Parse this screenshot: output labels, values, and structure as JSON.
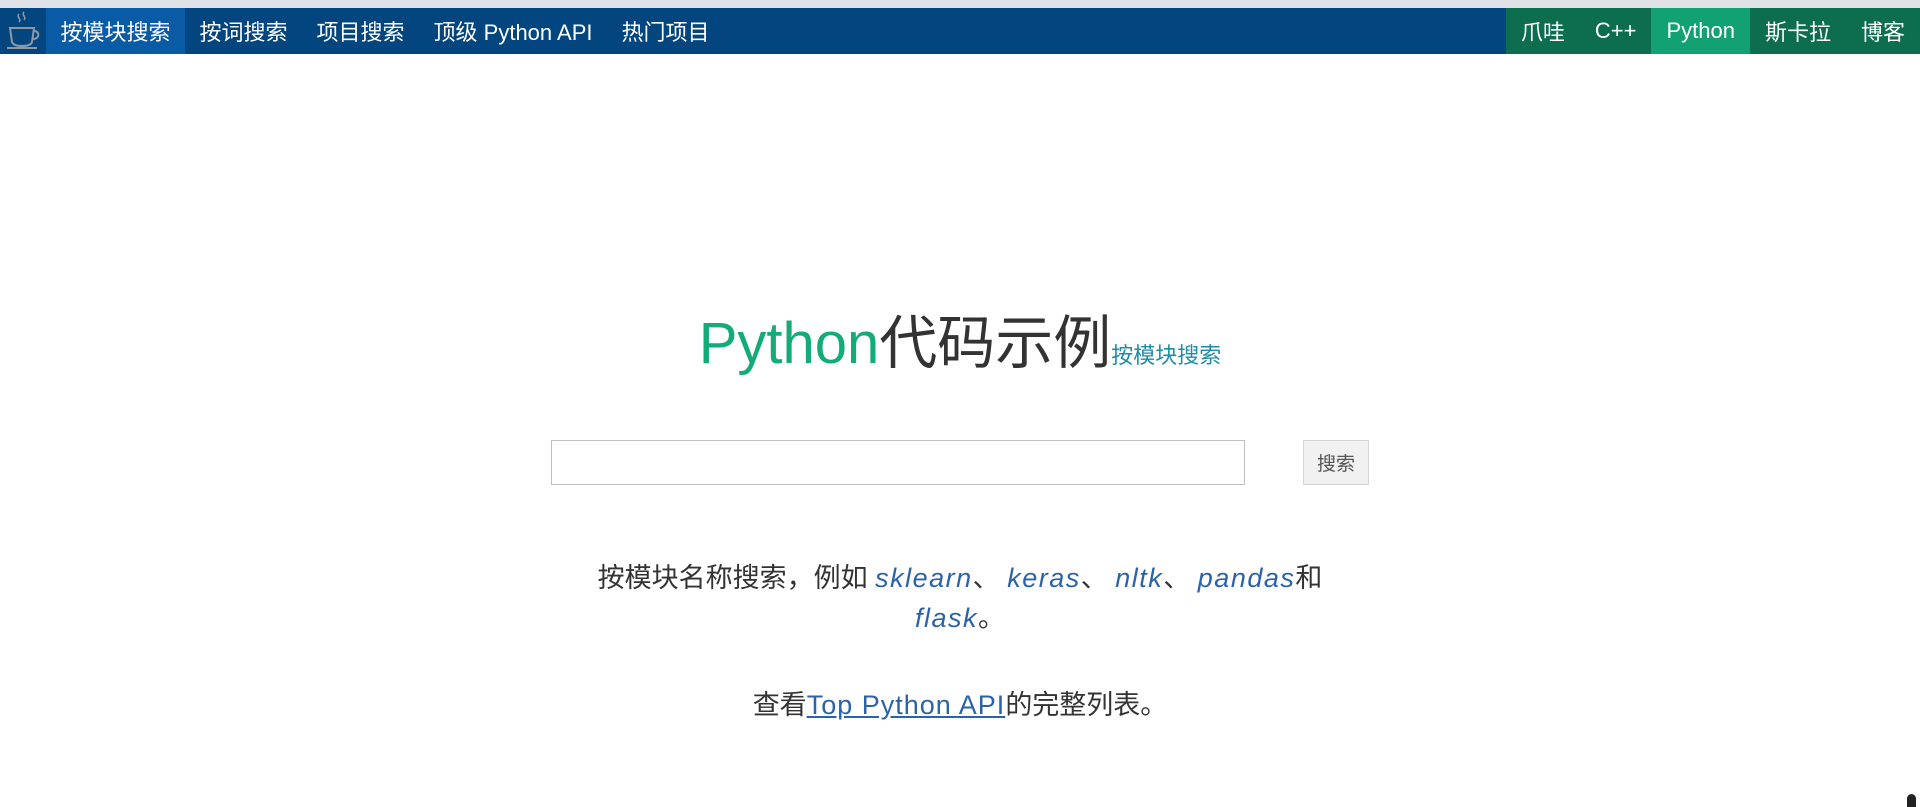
{
  "nav": {
    "left_items": [
      "按模块搜索",
      "按词搜索",
      "项目搜索",
      "顶级 Python API",
      "热门项目"
    ],
    "right_items": [
      "爪哇",
      "C++",
      "Python",
      "斯卡拉",
      "博客"
    ]
  },
  "hero": {
    "title_accent": "Python",
    "title_rest": "代码示例",
    "subtitle_link": "按模块搜索"
  },
  "search": {
    "value": "",
    "placeholder": "",
    "button_label": "搜索"
  },
  "examples": {
    "lead": "按模块名称搜索，例如 ",
    "modules": [
      "sklearn",
      "keras",
      "nltk",
      "pandas",
      "flask"
    ],
    "sep": "、 ",
    "and": "和",
    "end": "。"
  },
  "full_list": {
    "prefix": "查看",
    "link": "Top Python API",
    "suffix": "的完整列表。"
  },
  "colors": {
    "navbar": "#03457f",
    "nav_active": "#0a5ba6",
    "lang_bg": "#0c6e4e",
    "lang_active": "#11a173",
    "python_green": "#11ac78",
    "link_blue": "#2c63a8"
  },
  "icons": {
    "brand": "coffee-cup-icon"
  }
}
